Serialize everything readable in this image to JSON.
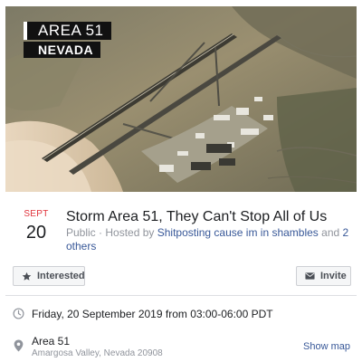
{
  "cover": {
    "badge_line1": "AREA 51",
    "badge_line2": "NEVADA"
  },
  "event": {
    "month": "SEPT",
    "day": "20",
    "title": "Storm Area 51, They Can't Stop All of Us",
    "meta_prefix": "Public · Hosted by ",
    "host_link": "Shitposting cause im in shambles",
    "meta_joiner": " and ",
    "others_link": "2 others"
  },
  "actions": {
    "interested_label": "Interested",
    "invite_label": "Invite"
  },
  "details": {
    "time": "Friday, 20 September 2019 from 03:00-06:00 PDT",
    "location_name": "Area 51",
    "location_address": "Amargosa Valley, Nevada 20908",
    "show_map_label": "Show map"
  },
  "icons": {
    "interested": "star-icon",
    "invite": "envelope-icon",
    "time": "clock-icon",
    "location": "map-pin-icon"
  },
  "colors": {
    "month_red": "#e0323a",
    "link_blue": "#385898",
    "meta_gray": "#90949c",
    "button_bg": "#f5f6f7",
    "button_border": "#ced0d4",
    "text_dark": "#1c1e21"
  }
}
